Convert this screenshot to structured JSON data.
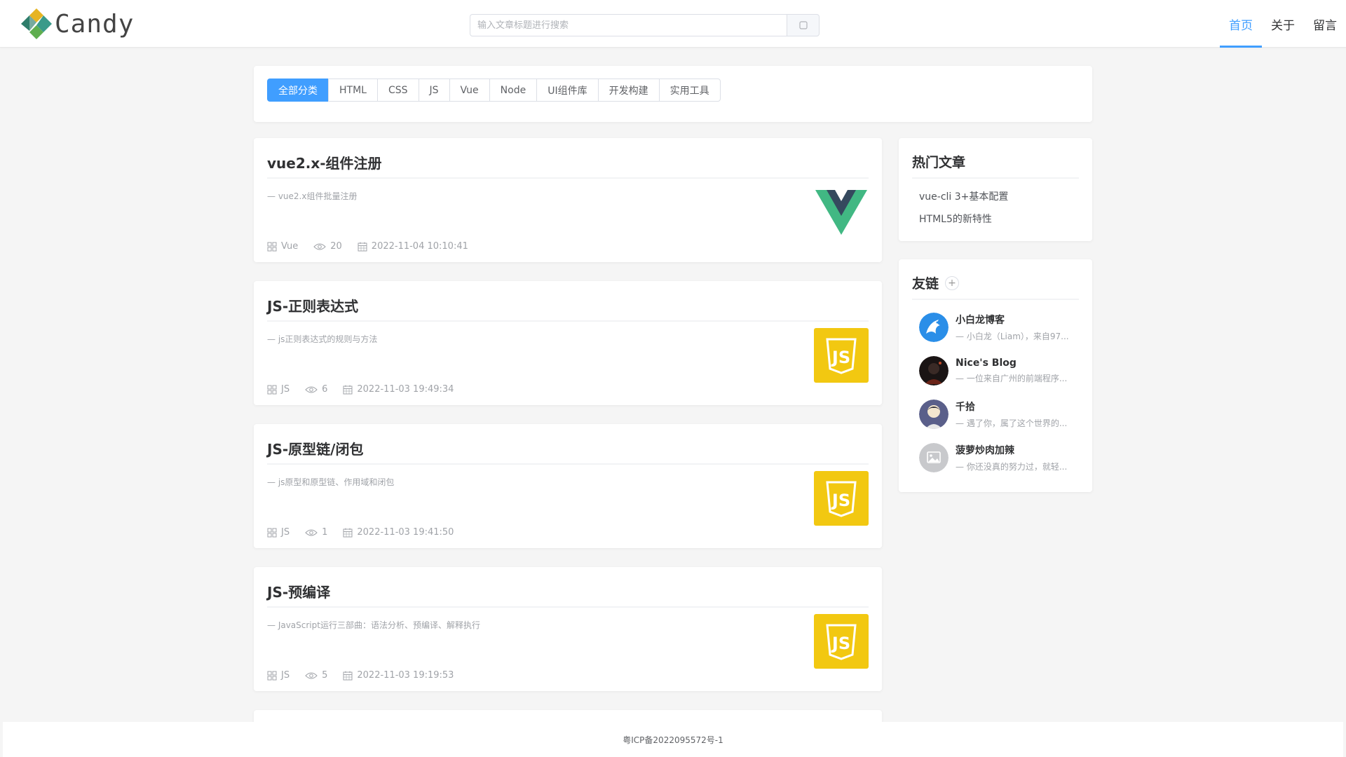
{
  "header": {
    "logo_text": "Candy",
    "search": {
      "placeholder": "输入文章标题进行搜索"
    },
    "nav": [
      {
        "label": "首页",
        "active": true
      },
      {
        "label": "关于",
        "active": false
      },
      {
        "label": "留言",
        "active": false
      }
    ]
  },
  "categories": [
    {
      "label": "全部分类",
      "active": true
    },
    {
      "label": "HTML"
    },
    {
      "label": "CSS"
    },
    {
      "label": "JS"
    },
    {
      "label": "Vue"
    },
    {
      "label": "Node"
    },
    {
      "label": "UI组件库"
    },
    {
      "label": "开发构建"
    },
    {
      "label": "实用工具"
    }
  ],
  "articles": [
    {
      "title": "vue2.x-组件注册",
      "desc": "— vue2.x组件批量注册",
      "category": "Vue",
      "views": "20",
      "date": "2022-11-04 10:10:41",
      "thumb": "vue-logo-icon"
    },
    {
      "title": "JS-正则表达式",
      "desc": "— js正则表达式的规则与方法",
      "category": "JS",
      "views": "6",
      "date": "2022-11-03 19:49:34",
      "thumb": "js-logo-icon"
    },
    {
      "title": "JS-原型链/闭包",
      "desc": "— js原型和原型链、作用域和闭包",
      "category": "JS",
      "views": "1",
      "date": "2022-11-03 19:41:50",
      "thumb": "js-logo-icon"
    },
    {
      "title": "JS-预编译",
      "desc": "— JavaScript运行三部曲：语法分析、预编译、解释执行",
      "category": "JS",
      "views": "5",
      "date": "2022-11-03 19:19:53",
      "thumb": "js-logo-icon"
    }
  ],
  "hot": {
    "title": "热门文章",
    "items": [
      "vue-cli 3+基本配置",
      "HTML5的新特性"
    ]
  },
  "friends": {
    "title": "友链",
    "add_label": "+",
    "items": [
      {
        "name": "小白龙博客",
        "desc": "— 小白龙（Liam），来自97...",
        "avatar": "dragon-avatar"
      },
      {
        "name": "Nice's Blog",
        "desc": "— 一位来自广州的前端程序...",
        "avatar": "dark-avatar"
      },
      {
        "name": "千拾",
        "desc": "— 遇了你，属了这个世界的...",
        "avatar": "character-avatar"
      },
      {
        "name": "菠萝炒肉加辣",
        "desc": "— 你还没真的努力过，就轻...",
        "avatar": "placeholder-image-avatar"
      }
    ]
  },
  "footer": {
    "icp": "粤ICP备2022095572号-1"
  },
  "colors": {
    "accent": "#409eff",
    "vue_green": "#41b883",
    "vue_dark": "#35495e",
    "js_yellow": "#f2c811"
  }
}
